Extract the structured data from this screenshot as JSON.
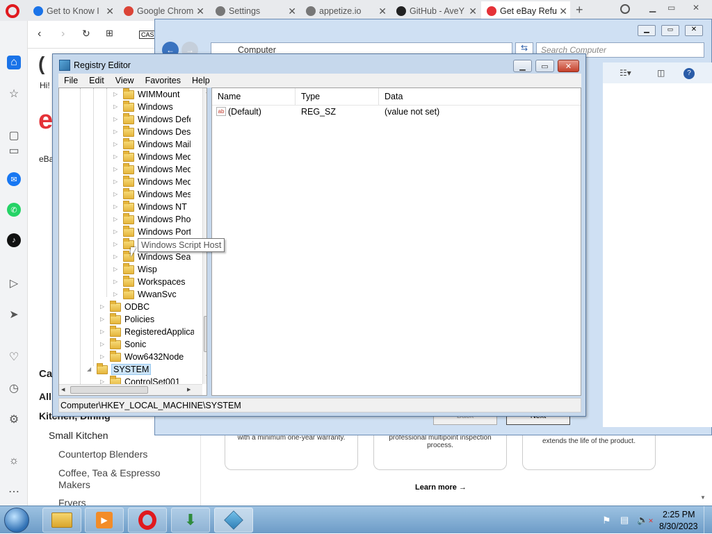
{
  "browser": {
    "tabs": [
      {
        "label": "Get to Know I",
        "color": "#1a73e8"
      },
      {
        "label": "Google Chrom",
        "color": "#db4437"
      },
      {
        "label": "Settings",
        "color": "#777777"
      },
      {
        "label": "appetize.io",
        "color": "#777777"
      },
      {
        "label": "GitHub - AveY",
        "color": "#222222"
      },
      {
        "label": "Get eBay Refu",
        "color": "#e53238"
      }
    ],
    "new_tab": "+",
    "cas": "CAS"
  },
  "ebay_page": {
    "greeting": "Hi!",
    "logo_letter": "e",
    "sub": "eBa",
    "cat_label": "Ca",
    "all_label": "All",
    "kitchen": "Kitchen, Dining",
    "small_kitchen": "Small Kitchen",
    "items": [
      "Countertop Blenders",
      "Coffee, Tea & Espresso Makers",
      "Fryers"
    ],
    "card_texts": [
      "with a minimum one-year warranty.",
      "professional multipoint inspection process.",
      "shed reduces harmful waste and extends the life of the product."
    ],
    "learn_more": "Learn more →",
    "back": "Back",
    "next": "Next"
  },
  "explorer": {
    "address": "Computer",
    "search_placeholder": "Search Computer"
  },
  "regedit": {
    "title": "Registry Editor",
    "menus": [
      "File",
      "Edit",
      "View",
      "Favorites",
      "Help"
    ],
    "tree": [
      {
        "label": "WIMMount",
        "level": 2
      },
      {
        "label": "Windows",
        "level": 2
      },
      {
        "label": "Windows Defe",
        "level": 2
      },
      {
        "label": "Windows Desk",
        "level": 2
      },
      {
        "label": "Windows Mail",
        "level": 2
      },
      {
        "label": "Windows Med",
        "level": 2
      },
      {
        "label": "Windows Med",
        "level": 2
      },
      {
        "label": "Windows Med",
        "level": 2
      },
      {
        "label": "Windows Mess",
        "level": 2
      },
      {
        "label": "Windows NT",
        "level": 2
      },
      {
        "label": "Windows Phot",
        "level": 2
      },
      {
        "label": "Windows Porta",
        "level": 2
      },
      {
        "label": "",
        "level": 2
      },
      {
        "label": "Windows Searc",
        "level": 2
      },
      {
        "label": "Wisp",
        "level": 2
      },
      {
        "label": "Workspaces",
        "level": 2
      },
      {
        "label": "WwanSvc",
        "level": 2
      },
      {
        "label": "ODBC",
        "level": 1
      },
      {
        "label": "Policies",
        "level": 1
      },
      {
        "label": "RegisteredApplica",
        "level": 1
      },
      {
        "label": "Sonic",
        "level": 1
      },
      {
        "label": "Wow6432Node",
        "level": 1
      },
      {
        "label": "SYSTEM",
        "level": 0
      },
      {
        "label": "ControlSet001",
        "level": 1
      }
    ],
    "tooltip": "Windows Script Host",
    "columns": [
      "Name",
      "Type",
      "Data"
    ],
    "rows": [
      {
        "name": "(Default)",
        "type": "REG_SZ",
        "data": "(value not set)"
      }
    ],
    "status": "Computer\\HKEY_LOCAL_MACHINE\\SYSTEM"
  },
  "taskbar": {
    "time": "2:25 PM",
    "date": "8/30/2023"
  }
}
